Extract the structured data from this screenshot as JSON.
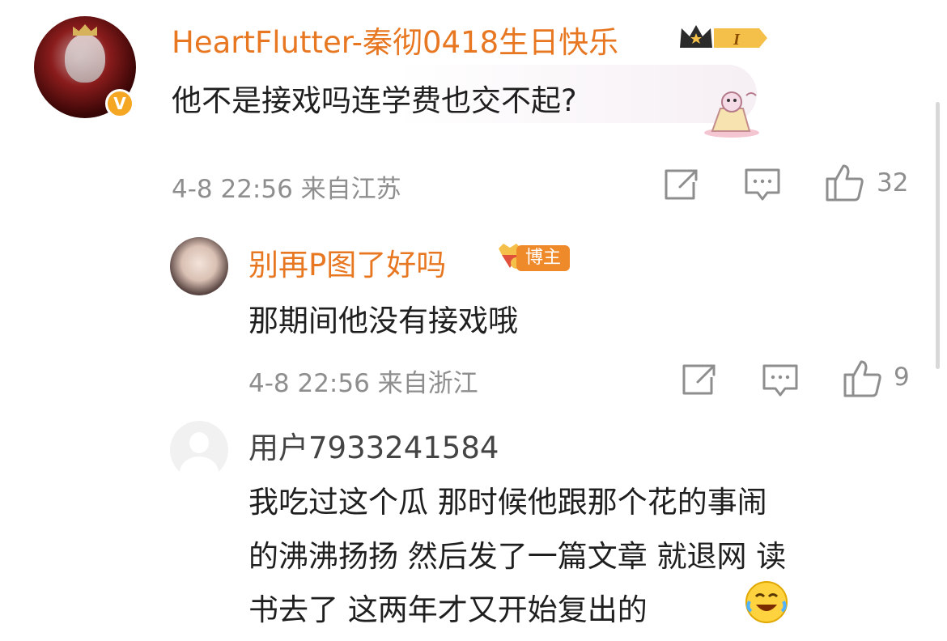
{
  "comments": [
    {
      "username": "HeartFlutter-秦彻0418生日快乐",
      "level_badge": "I",
      "text": "他不是接戏吗连学费也交不起?",
      "time_location": "4-8 22:56 来自江苏",
      "likes": "32",
      "verified_badge": "V"
    },
    {
      "username": "别再P图了好吗",
      "role_badge": "博主",
      "text": "那期间他没有接戏哦",
      "time_location": "4-8 22:56 来自浙江",
      "likes": "9"
    },
    {
      "username": "用户7933241584",
      "text_lines": [
        "我吃过这个瓜 那时候他跟那个花的事闹",
        "的沸沸扬扬 然后发了一篇文章 就退网 读",
        "书去了 这两年才又开始复出的"
      ]
    }
  ],
  "icons": [
    "repost-icon",
    "comment-icon",
    "like-icon",
    "laughing-crying-emoji",
    "crown-level-badge",
    "blogger-gem-icon"
  ],
  "colors": {
    "username": "#e87722",
    "meta": "#8e8e8e",
    "text": "#1f1f1f",
    "badge": "#ef8a2a",
    "verified": "#f5a623"
  }
}
